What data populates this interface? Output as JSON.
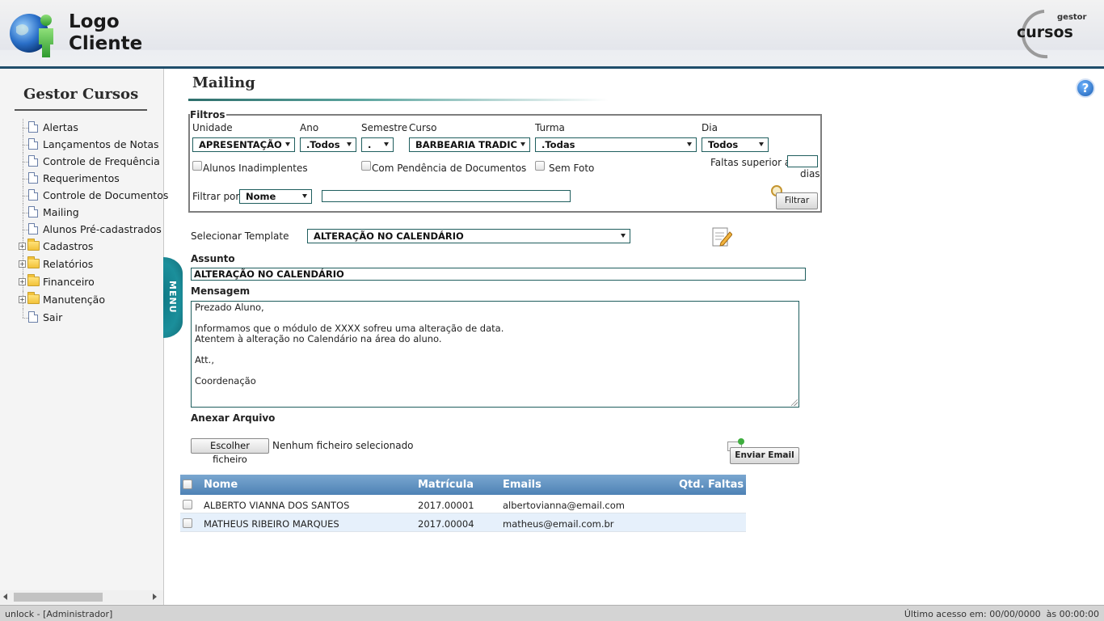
{
  "header": {
    "logo_line1": "Logo",
    "logo_line2": "Cliente",
    "brand_small": "gestor",
    "brand_big": "cursos"
  },
  "sidebar": {
    "title": "Gestor Cursos",
    "items": [
      {
        "label": "Alertas",
        "type": "doc"
      },
      {
        "label": "Lançamentos de Notas",
        "type": "doc"
      },
      {
        "label": "Controle de Frequência",
        "type": "doc"
      },
      {
        "label": "Requerimentos",
        "type": "doc"
      },
      {
        "label": "Controle de Documentos",
        "type": "doc"
      },
      {
        "label": "Mailing",
        "type": "doc"
      },
      {
        "label": "Alunos Pré-cadastrados",
        "type": "doc"
      },
      {
        "label": "Cadastros",
        "type": "folder"
      },
      {
        "label": "Relatórios",
        "type": "folder"
      },
      {
        "label": "Financeiro",
        "type": "folder"
      },
      {
        "label": "Manutenção",
        "type": "folder"
      },
      {
        "label": "Sair",
        "type": "doc"
      }
    ],
    "menu_tab": "MENU"
  },
  "page": {
    "title": "Mailing"
  },
  "filters": {
    "legend": "Filtros",
    "unidade": {
      "label": "Unidade",
      "value": "APRESENTAÇÃO"
    },
    "ano": {
      "label": "Ano",
      "value": ".Todos"
    },
    "semestre": {
      "label": "Semestre",
      "value": "."
    },
    "curso": {
      "label": "Curso",
      "value": "BARBEARIA TRADIC"
    },
    "turma": {
      "label": "Turma",
      "value": ".Todas"
    },
    "dia": {
      "label": "Dia",
      "value": "Todos"
    },
    "alunos_inadimplentes": "Alunos Inadimplentes",
    "pendencia_documentos": "Com Pendência de Documentos",
    "sem_foto": "Sem Foto",
    "faltas_superior": "Faltas superior a",
    "faltas_unit": "dias",
    "filtrar_por_label": "Filtrar por",
    "filtrar_por_value": "Nome",
    "filtrar_button": "Filtrar"
  },
  "template": {
    "label": "Selecionar Template",
    "value": "ALTERAÇÃO NO CALENDÁRIO"
  },
  "assunto": {
    "label": "Assunto",
    "value": "ALTERAÇÃO NO CALENDÁRIO"
  },
  "mensagem": {
    "label": "Mensagem",
    "value": "Prezado Aluno,\n\nInformamos que o módulo de XXXX sofreu uma alteração de data.\nAtentem à alteração no Calendário na área do aluno.\n\nAtt.,\n\nCoordenação"
  },
  "anexo": {
    "label": "Anexar Arquivo",
    "button": "Escolher ficheiro",
    "status": "Nenhum ficheiro selecionado"
  },
  "enviar_button": "Enviar Email",
  "table": {
    "headers": [
      "Nome",
      "Matrícula",
      "Emails",
      "Qtd. Faltas"
    ],
    "rows": [
      {
        "nome": "ALBERTO VIANNA DOS SANTOS",
        "matricula": "2017.00001",
        "email": "albertovianna@email.com",
        "faltas": ""
      },
      {
        "nome": "MATHEUS RIBEIRO MARQUES",
        "matricula": "2017.00004",
        "email": "matheus@email.com.br",
        "faltas": ""
      }
    ]
  },
  "status": {
    "left": "unlock - [Administrador]",
    "right": "Último acesso em: 00/00/0000  às 00:00:00"
  }
}
